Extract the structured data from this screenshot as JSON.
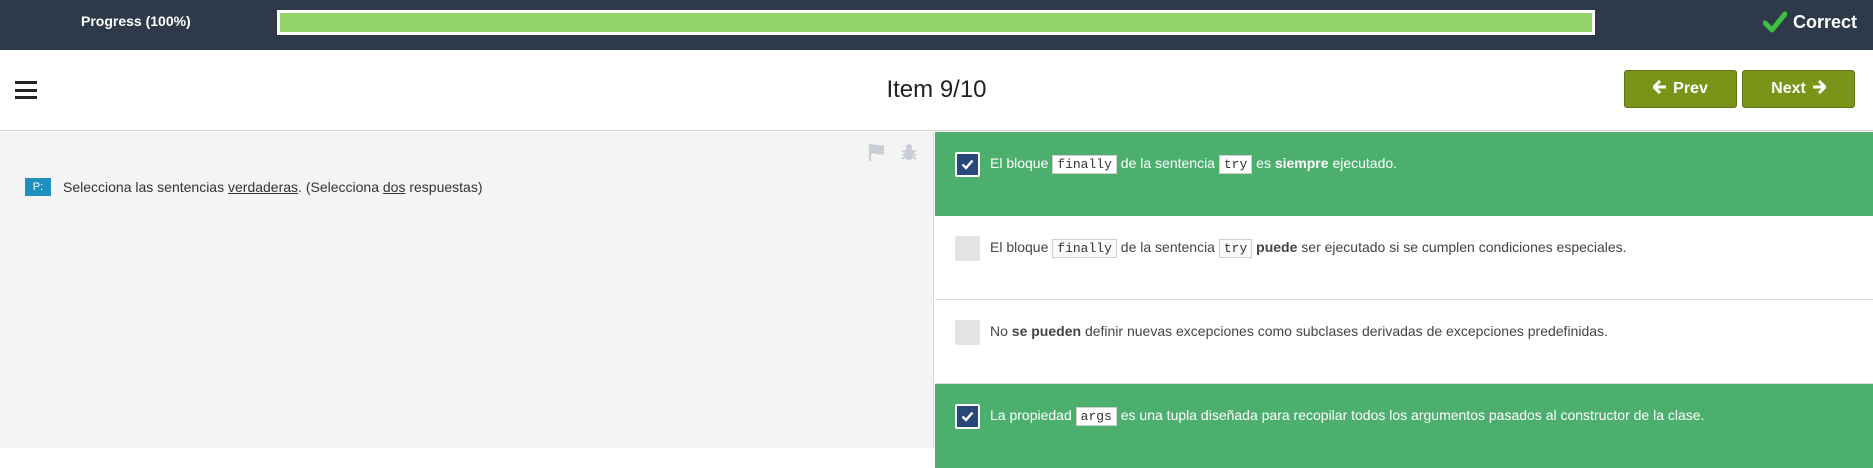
{
  "progress": {
    "label": "Progress (100%)",
    "percent": 100
  },
  "status": {
    "label": "Correct",
    "icon": "check-icon",
    "color": "#3fbf3f"
  },
  "header": {
    "title": "Item 9/10",
    "prev_label": "Prev",
    "next_label": "Next"
  },
  "tools": {
    "flag_icon": "flag-icon",
    "bug_icon": "bug-icon"
  },
  "question": {
    "badge": "P:",
    "part1": "Selecciona las sentencias",
    "underline1": "verdaderas",
    "part2": ". (Selecciona",
    "underline2": "dos",
    "part3": "respuestas)"
  },
  "options": [
    {
      "selected": true,
      "t1": "El bloque",
      "code1": "finally",
      "t2": "de la sentencia",
      "code2": "try",
      "t3": "es",
      "bold": "siempre",
      "t4": "ejecutado."
    },
    {
      "selected": false,
      "t1": "El bloque",
      "code1": "finally",
      "t2": "de la sentencia",
      "code2": "try",
      "bold": "puede",
      "t3": "ser ejecutado si se cumplen condiciones especiales."
    },
    {
      "selected": false,
      "t1": "No",
      "bold": "se pueden",
      "t2": "definir nuevas excepciones como subclases derivadas de excepciones predefinidas."
    },
    {
      "selected": true,
      "t1": "La propiedad",
      "code1": "args",
      "t2": "es una tupla diseñada para recopilar todos los argumentos pasados al constructor de la clase."
    }
  ]
}
